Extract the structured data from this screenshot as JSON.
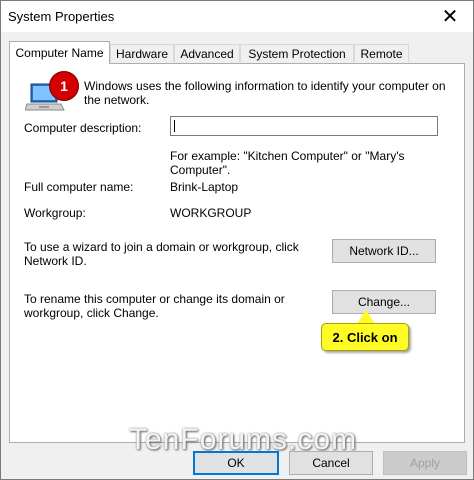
{
  "window": {
    "title": "System Properties",
    "close_glyph": "✕"
  },
  "tabs": [
    {
      "label": "Computer Name",
      "active": true
    },
    {
      "label": "Hardware",
      "active": false
    },
    {
      "label": "Advanced",
      "active": false
    },
    {
      "label": "System Protection",
      "active": false
    },
    {
      "label": "Remote",
      "active": false
    }
  ],
  "computer_name_tab": {
    "intro": "Windows uses the following information to identify your computer on the network.",
    "description_label": "Computer description:",
    "description_value": "",
    "description_example": "For example: \"Kitchen Computer\" or \"Mary's Computer\".",
    "full_name_label": "Full computer name:",
    "full_name_value": "Brink-Laptop",
    "workgroup_label": "Workgroup:",
    "workgroup_value": "WORKGROUP",
    "network_id_text": "To use a wizard to join a domain or workgroup, click Network ID.",
    "network_id_button": "Network ID...",
    "rename_text": "To rename this computer or change its domain or workgroup, click Change.",
    "change_button": "Change..."
  },
  "annotations": {
    "step_badge": "1",
    "callout": "2. Click on"
  },
  "watermark": "TenForums.com",
  "footer": {
    "ok": "OK",
    "cancel": "Cancel",
    "apply": "Apply"
  },
  "icons": {
    "computer": "computer-icon",
    "close": "close-icon"
  },
  "colors": {
    "accent": "#0078d7",
    "callout": "#fffb26",
    "badge": "#d40000"
  }
}
